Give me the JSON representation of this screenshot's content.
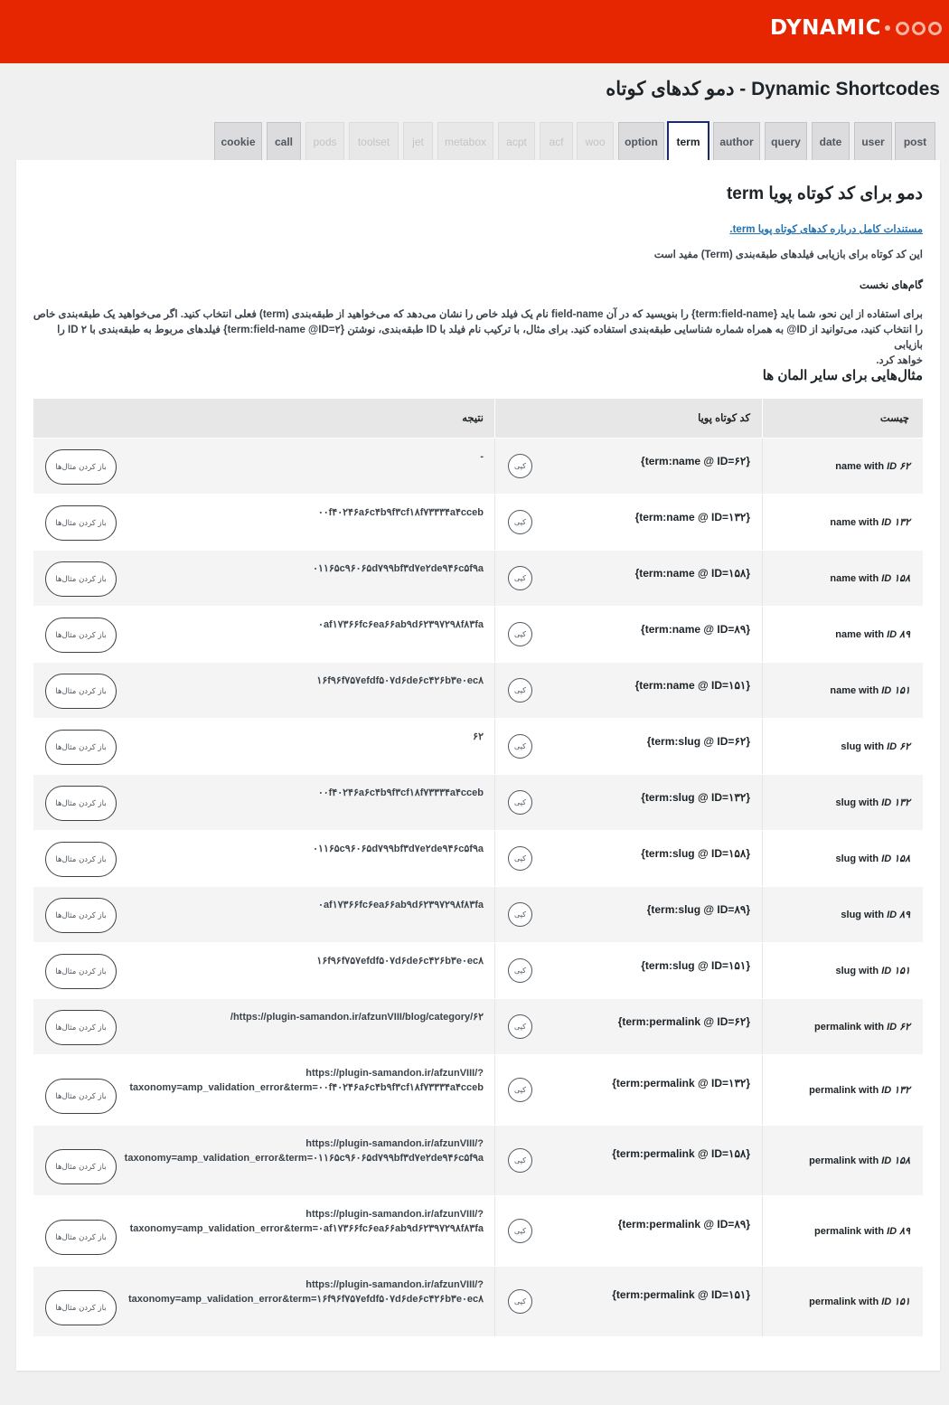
{
  "header": {
    "brand": "DYNAMIC"
  },
  "page_title": "Dynamic Shortcodes - دمو کدهای کوتاه",
  "tabs": [
    {
      "label": "post",
      "state": "normal"
    },
    {
      "label": "user",
      "state": "normal"
    },
    {
      "label": "date",
      "state": "normal"
    },
    {
      "label": "query",
      "state": "normal"
    },
    {
      "label": "author",
      "state": "normal"
    },
    {
      "label": "term",
      "state": "active"
    },
    {
      "label": "option",
      "state": "normal"
    },
    {
      "label": "woo",
      "state": "disabled"
    },
    {
      "label": "acf",
      "state": "disabled"
    },
    {
      "label": "acpt",
      "state": "disabled"
    },
    {
      "label": "metabox",
      "state": "disabled"
    },
    {
      "label": "jet",
      "state": "disabled"
    },
    {
      "label": "toolset",
      "state": "disabled"
    },
    {
      "label": "pods",
      "state": "disabled"
    },
    {
      "label": "call",
      "state": "normal"
    },
    {
      "label": "cookie",
      "state": "normal"
    }
  ],
  "content": {
    "heading": "دمو برای کد کوتاه پویا term",
    "doc_link": "مستندات کامل درباره کدهای کوتاه پویا term.",
    "intro": "این کد کوتاه برای بازیابی فیلدهای طبقه‌بندی (Term) مفید است",
    "steps_title": "گام‌های نخست",
    "body_lines": [
      "برای استفاده از این نحو، شما باید {term:field-name} را بنویسید که در آن field-name نام یک فیلد خاص را نشان می‌دهد که می‌خواهید از طبقه‌بندی (term) فعلی انتخاب کنید. اگر می‌خواهید یک طبقه‌بندی خاص",
      "را انتخاب کنید، می‌توانید از ID@ به همراه شماره شناسایی طبقه‌بندی استفاده کنید. برای مثال، با ترکیب نام فیلد با ID طبقه‌بندی، نوشتن {term:field-name @ID=۲} فیلدهای مربوط به طبقه‌بندی با ID ۲ را بازیابی",
      "خواهد کرد."
    ],
    "examples_title": "مثال‌هایی برای سایر المان ها"
  },
  "table": {
    "headers": {
      "what": "چیست",
      "shortcode": "کد کوتاه پویا",
      "result": "نتیجه"
    },
    "copy_label": "کپی",
    "open_label": "باز کردن مثال‌ها",
    "rows": [
      {
        "what_prefix": "name with ",
        "what_id": "ID ۶۲",
        "code": "{term:name @ ID=۶۲}",
        "result": [
          "-"
        ]
      },
      {
        "what_prefix": "name with ",
        "what_id": "ID ۱۳۲",
        "code": "{term:name @ ID=۱۳۲}",
        "result": [
          "۰۰f۴۰۲۴۶a۶c۴b۹f۳cf۱۸f۷۳۳۳۴a۴cceb"
        ]
      },
      {
        "what_prefix": "name with ",
        "what_id": "ID ۱۵۸",
        "code": "{term:name @ ID=۱۵۸}",
        "result": [
          "۰۱۱۶۵c۹۶۰۶۵d۷۹۹bf۳d۷e۲de۹۴۶c۵f۹a"
        ]
      },
      {
        "what_prefix": "name with ",
        "what_id": "ID ۸۹",
        "code": "{term:name @ ID=۸۹}",
        "result": [
          "۰af۱۷۳۶۶fc۶ea۶۶ab۹d۶۲۳۹۷۲۹۸f۸۳fa"
        ]
      },
      {
        "what_prefix": "name with ",
        "what_id": "ID ۱۵۱",
        "code": "{term:name @ ID=۱۵۱}",
        "result": [
          "۱۶f۹۶f۷۵۷efdf۵۰۷d۶de۶c۴۲۶b۳e۰ec۸"
        ]
      },
      {
        "what_prefix": "slug with ",
        "what_id": "ID ۶۲",
        "code": "{term:slug @ ID=۶۲}",
        "result": [
          "۶۲"
        ]
      },
      {
        "what_prefix": "slug with ",
        "what_id": "ID ۱۳۲",
        "code": "{term:slug @ ID=۱۳۲}",
        "result": [
          "۰۰f۴۰۲۴۶a۶c۴b۹f۳cf۱۸f۷۳۳۳۴a۴cceb"
        ]
      },
      {
        "what_prefix": "slug with ",
        "what_id": "ID ۱۵۸",
        "code": "{term:slug @ ID=۱۵۸}",
        "result": [
          "۰۱۱۶۵c۹۶۰۶۵d۷۹۹bf۳d۷e۲de۹۴۶c۵f۹a"
        ]
      },
      {
        "what_prefix": "slug with ",
        "what_id": "ID ۸۹",
        "code": "{term:slug @ ID=۸۹}",
        "result": [
          "۰af۱۷۳۶۶fc۶ea۶۶ab۹d۶۲۳۹۷۲۹۸f۸۳fa"
        ]
      },
      {
        "what_prefix": "slug with ",
        "what_id": "ID ۱۵۱",
        "code": "{term:slug @ ID=۱۵۱}",
        "result": [
          "۱۶f۹۶f۷۵۷efdf۵۰۷d۶de۶c۴۲۶b۳e۰ec۸"
        ]
      },
      {
        "what_prefix": "permalink with ",
        "what_id": "ID ۶۲",
        "code": "{term:permalink @ ID=۶۲}",
        "result": [
          "/https://plugin-samandon.ir/afzunVIII/blog/category/۶۲"
        ]
      },
      {
        "what_prefix": "permalink with ",
        "what_id": "ID ۱۳۲",
        "code": "{term:permalink @ ID=۱۳۲}",
        "result": [
          "https://plugin-samandon.ir/afzunVIII/?",
          "taxonomy=amp_validation_error&term=۰۰f۴۰۲۴۶a۶c۴b۹f۳cf۱۸f۷۳۳۳۴a۴cceb"
        ]
      },
      {
        "what_prefix": "permalink with ",
        "what_id": "ID ۱۵۸",
        "code": "{term:permalink @ ID=۱۵۸}",
        "result": [
          "https://plugin-samandon.ir/afzunVIII/?",
          "taxonomy=amp_validation_error&term=۰۱۱۶۵c۹۶۰۶۵d۷۹۹bf۳d۷e۲de۹۴۶c۵f۹a"
        ]
      },
      {
        "what_prefix": "permalink with ",
        "what_id": "ID ۸۹",
        "code": "{term:permalink @ ID=۸۹}",
        "result": [
          "https://plugin-samandon.ir/afzunVIII/?",
          "taxonomy=amp_validation_error&term=۰af۱۷۳۶۶fc۶ea۶۶ab۹d۶۲۳۹۷۲۹۸f۸۳fa"
        ]
      },
      {
        "what_prefix": "permalink with ",
        "what_id": "ID ۱۵۱",
        "code": "{term:permalink @ ID=۱۵۱}",
        "result": [
          "https://plugin-samandon.ir/afzunVIII/?",
          "taxonomy=amp_validation_error&term=۱۶f۹۶f۷۵۷efdf۵۰۷d۶de۶c۴۲۶b۳e۰ec۸"
        ]
      }
    ]
  }
}
